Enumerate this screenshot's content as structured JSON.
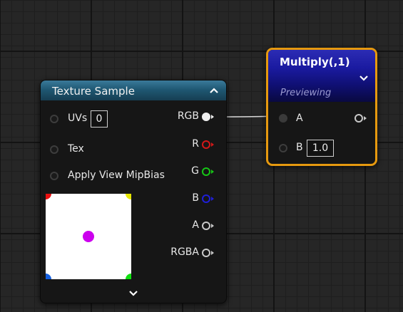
{
  "texture_sample": {
    "title": "Texture Sample",
    "inputs": [
      {
        "label": "UVs",
        "value": "0"
      },
      {
        "label": "Tex"
      },
      {
        "label": "Apply View MipBias"
      }
    ],
    "outputs": [
      {
        "label": "RGB",
        "color": "#f0f0f0"
      },
      {
        "label": "R",
        "color": "#d41818"
      },
      {
        "label": "G",
        "color": "#16c616"
      },
      {
        "label": "B",
        "color": "#1f1fd8"
      },
      {
        "label": "A",
        "color": "#c8c8c8"
      },
      {
        "label": "RGBA",
        "color": "#c8c8c8"
      }
    ],
    "preview_colors": {
      "center": "#cc00ee",
      "top_left": "#e81010",
      "top_right": "#e6e600",
      "bottom_left": "#1560e0",
      "bottom_right": "#10e010"
    }
  },
  "multiply": {
    "title": "Multiply(,1)",
    "subtitle": "Previewing",
    "inputs": [
      {
        "label": "A"
      },
      {
        "label": "B",
        "value": "1.0"
      }
    ],
    "border_color": "#e6990f"
  },
  "icons": [
    "chevron-up-icon",
    "chevron-down-icon"
  ]
}
